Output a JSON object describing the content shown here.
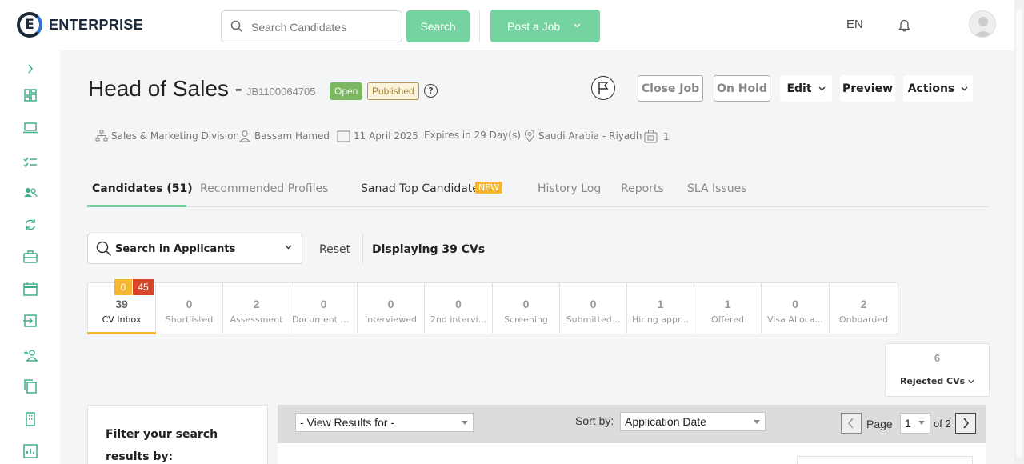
{
  "header": {
    "logo_letter": "E",
    "logo_text": "ENTERPRISE",
    "search_placeholder": "Search Candidates",
    "search_button": "Search",
    "post_job_button": "Post a Job",
    "language": "EN"
  },
  "job": {
    "title": "Head of Sales -",
    "id": "JB1100064705",
    "status_open": "Open",
    "status_published": "Published",
    "help_symbol": "?",
    "buttons": {
      "close_job": "Close Job",
      "on_hold": "On Hold",
      "edit": "Edit",
      "preview": "Preview",
      "actions": "Actions"
    },
    "meta": {
      "division": "Sales & Marketing Division",
      "owner": "Bassam Hamed",
      "date": "11 April 2025",
      "expires": "Expires in 29 Day(s)",
      "location": "Saudi Arabia - Riyadh",
      "openings": "1"
    }
  },
  "tabs": [
    {
      "label": "Candidates (51)",
      "active": true
    },
    {
      "label": "Recommended Profiles"
    },
    {
      "label": "Sanad Top Candidates",
      "badge": "NEW"
    },
    {
      "label": "History Log"
    },
    {
      "label": "Reports"
    },
    {
      "label": "SLA Issues"
    }
  ],
  "applicants": {
    "search_label": "Search in Applicants",
    "reset": "Reset",
    "displaying": "Displaying 39 CVs"
  },
  "pipeline": [
    {
      "count": "39",
      "label": "CV Inbox",
      "badge_new": "0",
      "badge_total": "45"
    },
    {
      "count": "0",
      "label": "Shortlisted"
    },
    {
      "count": "2",
      "label": "Assessment"
    },
    {
      "count": "0",
      "label": "Document Co..."
    },
    {
      "count": "0",
      "label": "Interviewed"
    },
    {
      "count": "0",
      "label": "2nd intervi..."
    },
    {
      "count": "0",
      "label": "Screening"
    },
    {
      "count": "0",
      "label": "Submitted..."
    },
    {
      "count": "1",
      "label": "Hiring appr..."
    },
    {
      "count": "1",
      "label": "Offered"
    },
    {
      "count": "0",
      "label": "Visa Alloca..."
    },
    {
      "count": "2",
      "label": "Onboarded"
    }
  ],
  "rejected": {
    "count": "6",
    "label": "Rejected CVs"
  },
  "filters": {
    "label": "Filter your search results by:"
  },
  "results": {
    "view_for": "- View Results for -",
    "sort_label": "Sort by:",
    "sort_value": "Application Date",
    "page_label": "Page",
    "page_value": "1",
    "of_pages": "of 2"
  },
  "colors": {
    "accent_green": "#74d3a0",
    "open_green": "#7bb661",
    "orange": "#f5b731",
    "red": "#d9472b"
  }
}
